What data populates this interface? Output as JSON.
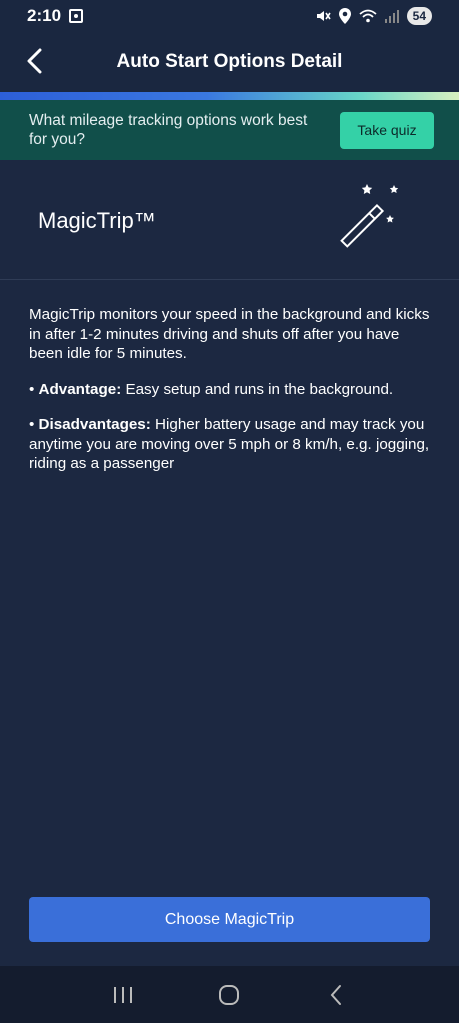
{
  "status_bar": {
    "time": "2:10",
    "battery": "54",
    "icons": [
      "screenshot-icon",
      "mute-icon",
      "location-icon",
      "wifi-icon",
      "signal-icon"
    ]
  },
  "header": {
    "title": "Auto Start Options Detail",
    "back_icon": "chevron-left-icon"
  },
  "quiz_banner": {
    "text": "What mileage tracking options work best for you?",
    "button_label": "Take quiz"
  },
  "option": {
    "name": "MagicTrip™",
    "icon": "magic-wand-icon"
  },
  "description": {
    "intro": "MagicTrip monitors your speed in the background and kicks in after 1-2 minutes driving and shuts off after you have been idle for 5 minutes.",
    "advantage_label": "Advantage:",
    "advantage_text": " Easy setup and runs in the background.",
    "disadvantage_label": "Disadvantages:",
    "disadvantage_text": " Higher battery usage and may track you anytime you are moving over 5 mph or 8 km/h, e.g. jogging, riding as a passenger"
  },
  "cta": {
    "label": "Choose MagicTrip"
  },
  "nav_bar": {
    "icons": [
      "recent-apps-icon",
      "home-icon",
      "back-icon"
    ]
  },
  "colors": {
    "background": "#1c2841",
    "banner": "#114f4a",
    "quiz_button": "#34d1a7",
    "cta": "#3a6fd9"
  }
}
